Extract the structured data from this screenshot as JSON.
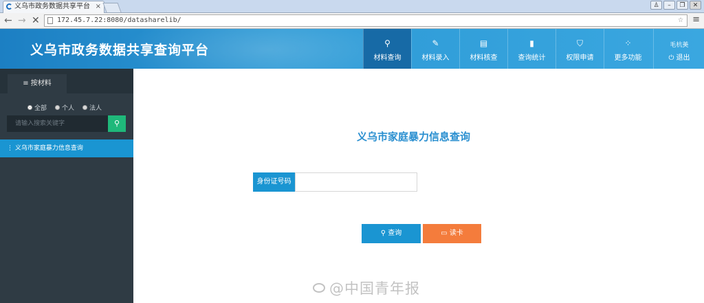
{
  "browser": {
    "tab_title": "义乌市政务数据共享平台",
    "tab_close": "×",
    "url": "172.45.7.22:8080/datasharelib/",
    "window_buttons": [
      "♙",
      "–",
      "❐",
      "✕"
    ],
    "nav": {
      "back": "←",
      "forward": "→",
      "stop": "✕"
    },
    "star": "☆",
    "menu": "≡"
  },
  "header": {
    "title": "义乌市政务数据共享查询平台",
    "nav_items": [
      {
        "icon": "search-icon",
        "glyph": "⚲",
        "label": "材料查询",
        "active": true
      },
      {
        "icon": "pen-icon",
        "glyph": "✎",
        "label": "材料录入",
        "active": false
      },
      {
        "icon": "card-icon",
        "glyph": "▤",
        "label": "材料核查",
        "active": false
      },
      {
        "icon": "bar-chart-icon",
        "glyph": "▮",
        "label": "查询统计",
        "active": false
      },
      {
        "icon": "shield-icon",
        "glyph": "⛉",
        "label": "权限申请",
        "active": false
      },
      {
        "icon": "grid-icon",
        "glyph": "⁘",
        "label": "更多功能",
        "active": false
      }
    ],
    "user": {
      "name": "毛杭美",
      "logout_icon": "⏻",
      "logout_label": "退出"
    }
  },
  "sidebar": {
    "tab_icon": "≡",
    "tab_label": "按材料",
    "radios": [
      {
        "label": "全部",
        "checked": true
      },
      {
        "label": "个人",
        "checked": false
      },
      {
        "label": "法人",
        "checked": false
      }
    ],
    "search_placeholder": "请输入搜索关键字",
    "search_icon": "⚲",
    "items": [
      {
        "marker": "⋮",
        "label": "义乌市家庭暴力信息查询"
      }
    ]
  },
  "main": {
    "title": "义乌市家庭暴力信息查询",
    "id_label": "身份证号码",
    "id_value": "",
    "query_icon": "⚲",
    "query_label": "查询",
    "read_icon": "▭",
    "read_label": "读卡"
  },
  "watermark": "@中国青年报"
}
